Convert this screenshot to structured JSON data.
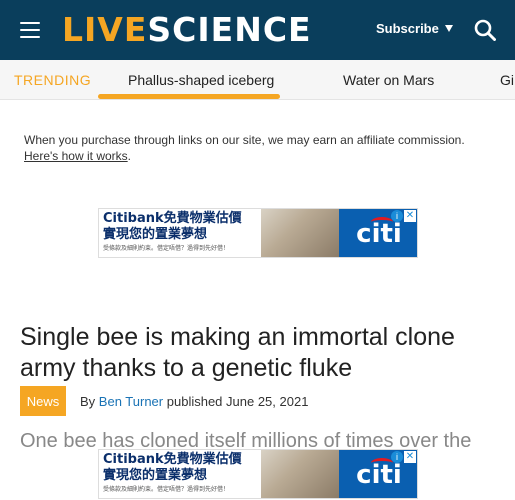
{
  "header": {
    "logo_live": "LIVE",
    "logo_science": "SCIENCE",
    "subscribe_label": "Subscribe"
  },
  "trending": {
    "label": "TRENDING",
    "items": [
      "Phallus-shaped iceberg",
      "Water on Mars",
      "Gi"
    ]
  },
  "affiliate": {
    "text": "When you purchase through links on our site, we may earn an affiliate commission.",
    "link": "Here's how it works",
    "link_suffix": "."
  },
  "ad": {
    "headline_1": "Citibank免費物業估價",
    "headline_2": "實現您的置業夢想",
    "fine_print": "受條款及細則約束。借定唔借？過得到先好借！",
    "brand": "citi",
    "info": "i",
    "close": "✕"
  },
  "article": {
    "headline": "Single bee is making an immortal clone army thanks to a genetic fluke",
    "category": "News",
    "by": "By",
    "author": "Ben Turner",
    "published": "published June 25, 2021",
    "lede": "One bee has cloned itself millions of times over the"
  },
  "colors": {
    "header_bg": "#0a3e5c",
    "accent": "#f5a623",
    "link": "#1a73b5"
  }
}
